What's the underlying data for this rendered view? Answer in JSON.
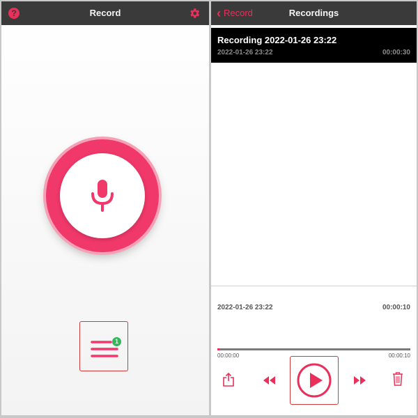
{
  "colors": {
    "accent": "#e8305a",
    "header": "#3a3a3a",
    "badge": "#35b65a"
  },
  "left": {
    "title": "Record",
    "help_icon": "question-mark-icon",
    "help_glyph": "?",
    "settings_icon": "gear-icon",
    "record_icon": "microphone-icon",
    "list_icon": "list-icon",
    "badge_count": "1"
  },
  "right": {
    "back_label": "Record",
    "back_glyph": "‹",
    "title": "Recordings",
    "recordings": [
      {
        "name": "Recording 2022-01-26 23:22",
        "date": "2022-01-26 23:22",
        "duration": "00:00:30"
      }
    ],
    "player": {
      "title": "2022-01-26 23:22",
      "duration": "00:00:10",
      "elapsed": "00:00:00",
      "total": "00:00:10",
      "progress": 0.01
    },
    "controls": [
      "share-icon",
      "rewind-icon",
      "play-icon",
      "fast-forward-icon",
      "trash-icon"
    ]
  }
}
